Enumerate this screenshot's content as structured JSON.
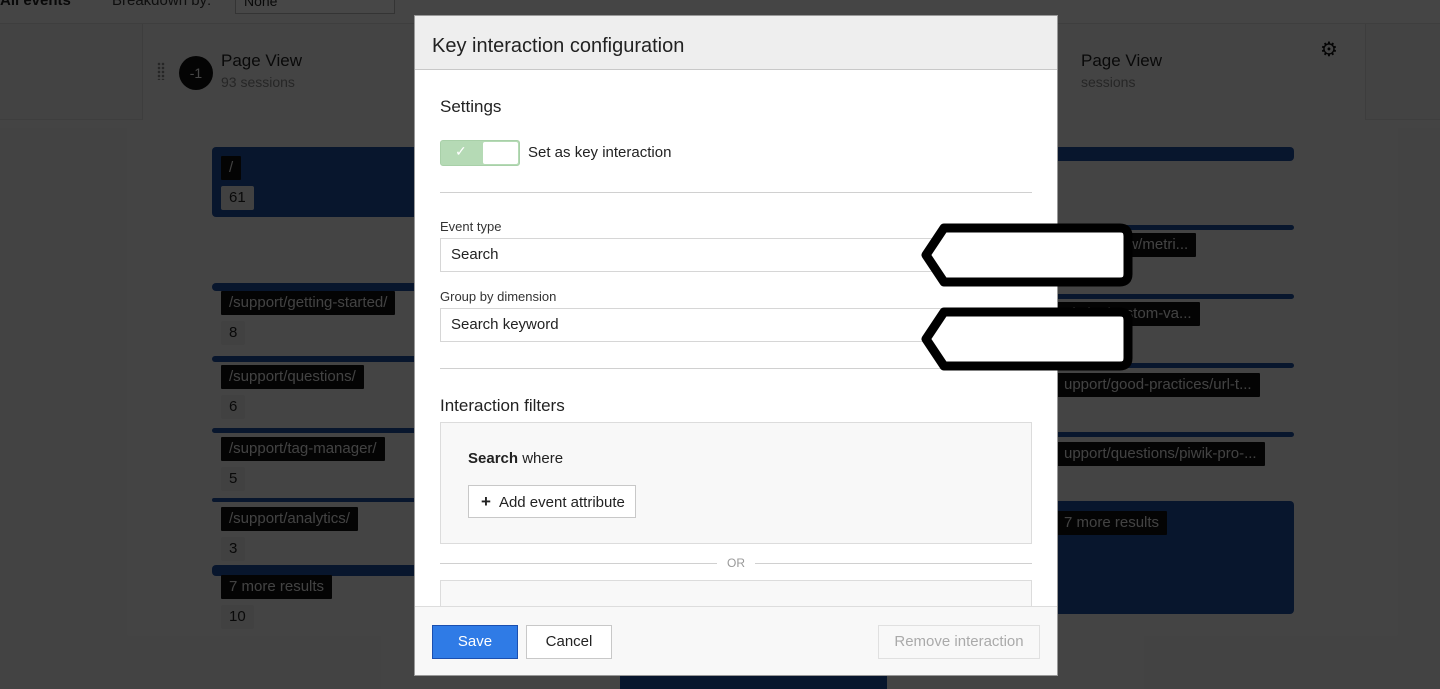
{
  "background": {
    "topbar": {
      "title": "All events",
      "breakdown_label": "Breakdown by:",
      "breakdown_value": "None"
    },
    "steps": [
      {
        "badge": "-1",
        "title": "Page View",
        "subtitle": "93 sessions"
      },
      {
        "title": "Page View",
        "subtitle": "sessions",
        "icon": "gear-icon"
      }
    ],
    "left_flow": [
      {
        "label": "/",
        "count": "61"
      },
      {
        "label": "/support/getting-started/",
        "count": "8"
      },
      {
        "label": "/support/questions/",
        "count": "6"
      },
      {
        "label": "/support/tag-manager/",
        "count": "5"
      },
      {
        "label": "/support/analytics/",
        "count": "3"
      },
      {
        "label": "7 more results",
        "count": "10"
      }
    ],
    "right_flow": [
      {
        "label": "alytics-new/metri..."
      },
      {
        "label": "alytics/custom-va..."
      },
      {
        "label": "upport/good-practices/url-t..."
      },
      {
        "label": "upport/questions/piwik-pro-..."
      },
      {
        "label": "7 more results"
      }
    ],
    "colors": {
      "flow_blue": "#1e4fa3"
    }
  },
  "modal": {
    "title": "Key interaction configuration",
    "settings": {
      "heading": "Settings",
      "toggle_label": "Set as key interaction",
      "toggle_on": true
    },
    "event_type": {
      "label": "Event type",
      "value": "Search"
    },
    "group_by": {
      "label": "Group by dimension",
      "value": "Search keyword"
    },
    "filters": {
      "heading": "Interaction filters",
      "where_bold": "Search",
      "where_text": " where",
      "add_attribute": "Add event attribute",
      "or_label": "OR"
    },
    "footer": {
      "save": "Save",
      "cancel": "Cancel",
      "remove": "Remove interaction"
    },
    "colors": {
      "primary": "#2f7be6",
      "toggle_on": "#b5dab5"
    }
  }
}
